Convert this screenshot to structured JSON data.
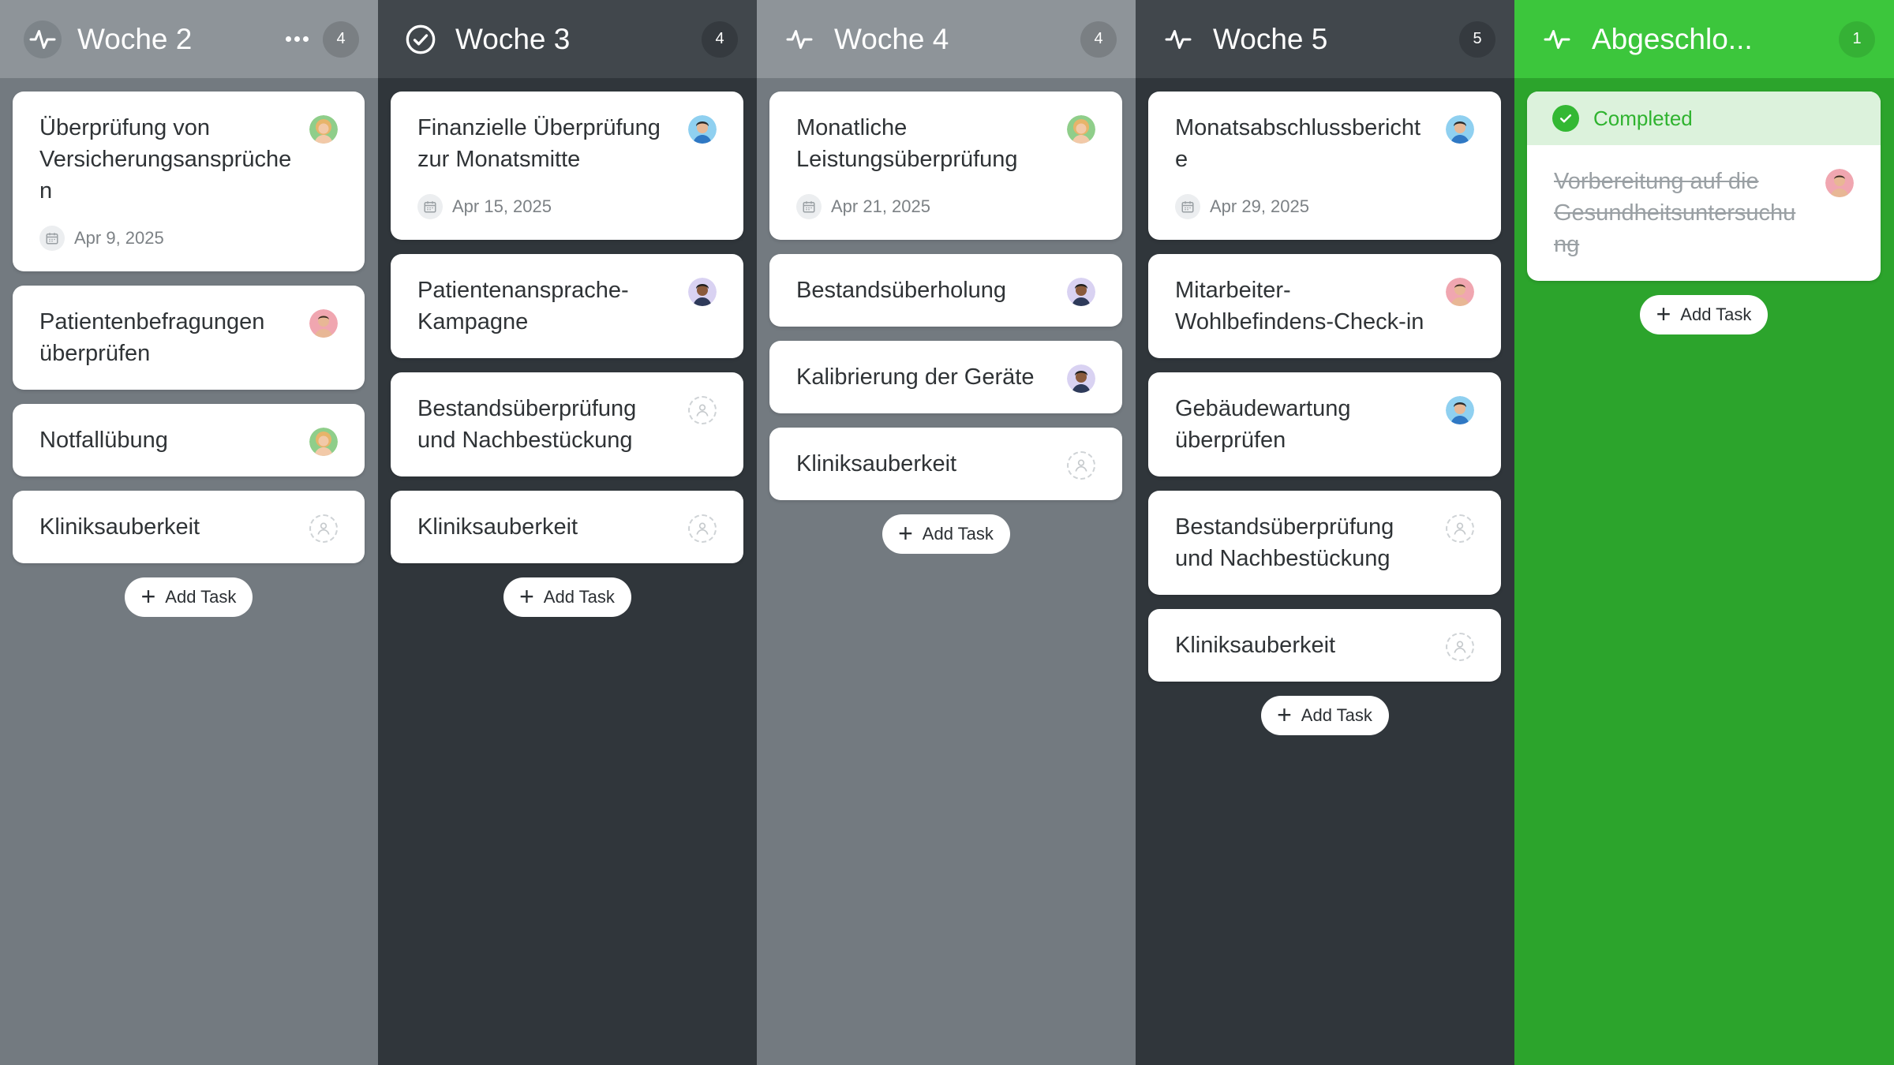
{
  "columns": [
    {
      "title": "Woche 2",
      "count": "4",
      "icon": "activity-pulse-icon",
      "tasks": [
        {
          "title": "Überprüfung von Versicherungsansprüche n",
          "date": "Apr 9, 2025",
          "avatar": "woman-blonde-avatar"
        },
        {
          "title": "Patientenbefragungen überprüfen",
          "date": "",
          "avatar": "man-red-shirt-avatar"
        },
        {
          "title": "Notfallübung",
          "date": "",
          "avatar": "woman-blonde-avatar"
        },
        {
          "title": "Kliniksauberkeit",
          "date": "",
          "avatar": "unassigned-user-icon"
        }
      ]
    },
    {
      "title": "Woche 3",
      "count": "4",
      "icon": "check-circle-icon",
      "tasks": [
        {
          "title": "Finanzielle Überprüfung zur Monatsmitte",
          "date": "Apr 15, 2025",
          "avatar": "man-blue-avatar"
        },
        {
          "title": "Patientenansprache-Kampagne",
          "date": "",
          "avatar": "man-dark-avatar"
        },
        {
          "title": "Bestandsüberprüfung und Nachbestückung",
          "date": "",
          "avatar": "unassigned-user-icon"
        },
        {
          "title": "Kliniksauberkeit",
          "date": "",
          "avatar": "unassigned-user-icon"
        }
      ]
    },
    {
      "title": "Woche 4",
      "count": "4",
      "icon": "activity-pulse-icon",
      "tasks": [
        {
          "title": "Monatliche Leistungsüberprüfung",
          "date": "Apr 21, 2025",
          "avatar": "woman-blonde-avatar"
        },
        {
          "title": "Bestandsüberholung",
          "date": "",
          "avatar": "man-dark-avatar"
        },
        {
          "title": "Kalibrierung der Geräte",
          "date": "",
          "avatar": "man-dark-avatar"
        },
        {
          "title": "Kliniksauberkeit",
          "date": "",
          "avatar": "unassigned-user-icon"
        }
      ]
    },
    {
      "title": "Woche 5",
      "count": "5",
      "icon": "activity-pulse-icon",
      "tasks": [
        {
          "title": "Monatsabschlussbericht e",
          "date": "Apr 29, 2025",
          "avatar": "man-blue-avatar"
        },
        {
          "title": "Mitarbeiter-Wohlbefindens-Check-in",
          "date": "",
          "avatar": "man-red-shirt-avatar"
        },
        {
          "title": "Gebäudewartung überprüfen",
          "date": "",
          "avatar": "man-blue-avatar"
        },
        {
          "title": "Bestandsüberprüfung und Nachbestückung",
          "date": "",
          "avatar": "unassigned-user-icon"
        },
        {
          "title": "Kliniksauberkeit",
          "date": "",
          "avatar": "unassigned-user-icon"
        }
      ]
    },
    {
      "title": "Abgeschlo...",
      "count": "1",
      "icon": "activity-pulse-icon",
      "completed_label": "Completed",
      "tasks": [
        {
          "title": "Vorbereitung auf die Gesundheitsuntersuchu ng",
          "date": "",
          "avatar": "man-red-shirt-avatar"
        }
      ]
    }
  ],
  "add_task_label": "Add Task",
  "colors": {
    "light_column": "#737a80",
    "dark_column": "#30363b",
    "done_column": "#2ca42c",
    "done_header": "#3cc63c",
    "completed_text": "#2fb32f"
  }
}
